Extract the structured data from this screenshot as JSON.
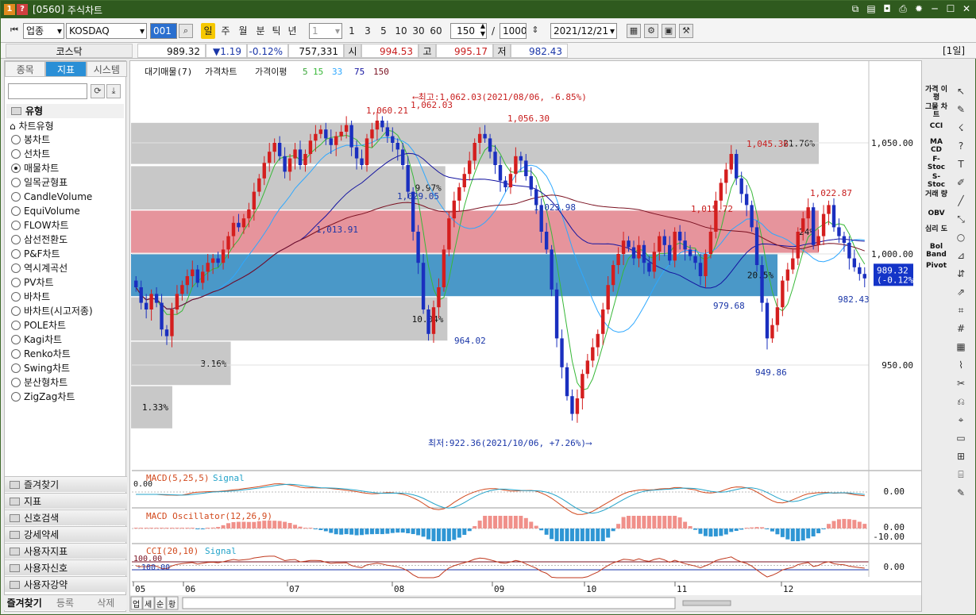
{
  "window": {
    "screen_no": "[0560]",
    "title": "주식차트",
    "badge1": "1",
    "badge2": "?"
  },
  "toolbar": {
    "category": "업종",
    "symbol": "KOSDAQ",
    "code": "001",
    "periods": [
      "일",
      "주",
      "월",
      "분",
      "틱",
      "년"
    ],
    "active_period": "일",
    "interval": "1",
    "intervals": [
      "1",
      "3",
      "5",
      "10",
      "30",
      "60"
    ],
    "count": "150",
    "total": "1000",
    "separator": "/",
    "date": "2021/12/21"
  },
  "infobar": {
    "name": "코스닥",
    "price": "989.32",
    "change": "▼1.19",
    "change_pct": "-0.12%",
    "volume": "757,331",
    "open_label": "시",
    "open": "994.53",
    "high_label": "고",
    "high": "995.17",
    "low_label": "저",
    "low": "982.43",
    "period_tag": "[1일]"
  },
  "left_panel": {
    "tabs": [
      "종목",
      "지표",
      "시스템"
    ],
    "active_tab": "지표",
    "type_header": "유형",
    "chart_type_group": "차트유형",
    "chart_types": [
      "봉차트",
      "선차트",
      "매물차트",
      "일목균형표",
      "CandleVolume",
      "EquiVolume",
      "FLOW차트",
      "삼선전환도",
      "P&F차트",
      "역시계곡선",
      "PV차트",
      "바차트",
      "바차트(시고저종)",
      "POLE차트",
      "Kagi차트",
      "Renko차트",
      "Swing차트",
      "분산형차트",
      "ZigZag차트"
    ],
    "selected_chart_type": "매물차트",
    "folders": [
      "즐겨찾기",
      "지표",
      "신호검색",
      "강세약세",
      "사용자지표",
      "사용자신호",
      "사용자강약"
    ],
    "bottom_tabs": [
      "즐겨찾기",
      "등록",
      "삭제"
    ]
  },
  "chart": {
    "legend": [
      "대기매물(7)",
      "가격차트",
      "가격이평",
      "5",
      "15",
      "33",
      "75",
      "150"
    ],
    "legend_colors": [
      "#222222",
      "#222222",
      "#3aa63a",
      "#38b838",
      "#2ea8ff",
      "#1414a0",
      "#7a1020"
    ],
    "annot_high": "⟵최고:1,062.03(2021/08/06, -6.85%)",
    "annot_low": "최저:922.36(2021/10/06, +7.26%)⟶",
    "price_labels": [
      {
        "text": "1,060.21",
        "color": "#c81e1e"
      },
      {
        "text": "1,062.03",
        "color": "#c81e1e"
      },
      {
        "text": "1,056.30",
        "color": "#c81e1e"
      },
      {
        "text": "1,045.36",
        "color": "#c81e1e"
      },
      {
        "text": "1,022.87",
        "color": "#c81e1e"
      },
      {
        "text": "1,015.72",
        "color": "#c81e1e"
      },
      {
        "text": "1,013.91",
        "color": "#1a36a8"
      },
      {
        "text": "1,029.05",
        "color": "#1a36a8"
      },
      {
        "text": "1,023.98",
        "color": "#1a36a8"
      },
      {
        "text": "964.02",
        "color": "#1a36a8"
      },
      {
        "text": "979.68",
        "color": "#1a36a8"
      },
      {
        "text": "949.86",
        "color": "#1a36a8"
      },
      {
        "text": "982.43",
        "color": "#1a36a8"
      }
    ],
    "volume_profile": [
      {
        "pct": "1.33%",
        "size": 0.06,
        "color": "#c8c8c8"
      },
      {
        "pct": "3.16%",
        "size": 0.145,
        "color": "#c8c8c8"
      },
      {
        "pct": "10.04%",
        "size": 0.46,
        "color": "#c8c8c8"
      },
      {
        "pct": "20.5%",
        "size": 0.94,
        "color": "#4a98c8"
      },
      {
        "pct": "24%",
        "size": 1.0,
        "color": "#e6949c"
      },
      {
        "pct": "9.97%",
        "size": 0.457,
        "color": "#c8c8c8"
      },
      {
        "pct": "21.76%",
        "size": 1.0,
        "color": "#c8c8c8"
      }
    ],
    "y_axis": [
      "1,050.00",
      "1,000.00",
      "950.00"
    ],
    "current_price": "989.32",
    "current_change": "(-0.12%)",
    "x_axis": [
      "05",
      "06",
      "07",
      "08",
      "09",
      "10",
      "11",
      "12"
    ],
    "bottom_icons": [
      "업",
      "세",
      "순",
      "황"
    ]
  },
  "macd": {
    "title": "MACD(5,25,5)",
    "signal": "Signal",
    "zero": "0.00",
    "axis": "0.00"
  },
  "osc": {
    "title": "MACD Oscillator(12,26,9)",
    "axis_a": "0.00",
    "axis_b": "-10.00"
  },
  "cci": {
    "title": "CCI(20,10)",
    "signal": "Signal",
    "ref_a": "100.00",
    "ref_b": "-100.00",
    "axis": "0.00"
  },
  "right_bar": [
    "가격 이평",
    "그물 차트",
    "CCI",
    "MA CD",
    "F-Stoc",
    "S-Stoc",
    "거래 량",
    "OBV",
    "심리 도",
    "Bol Band",
    "Pivot"
  ],
  "chart_data": {
    "type": "candlestick",
    "title": "KOSDAQ",
    "ylim": [
      920,
      1075
    ],
    "ylabel": "",
    "xlabel": "",
    "x_ticks": [
      "05",
      "06",
      "07",
      "08",
      "09",
      "10",
      "11",
      "12"
    ],
    "close": [
      985,
      978,
      975,
      982,
      978,
      966,
      963,
      975,
      982,
      986,
      990,
      993,
      987,
      992,
      996,
      998,
      996,
      1002,
      1008,
      1014,
      1012,
      1016,
      1020,
      1028,
      1034,
      1041,
      1046,
      1050,
      1044,
      1037,
      1043,
      1047,
      1040,
      1045,
      1051,
      1054,
      1056,
      1052,
      1049,
      1053,
      1055,
      1058,
      1048,
      1043,
      1040,
      1052,
      1056,
      1060,
      1057,
      1053,
      1050,
      1047,
      1040,
      1028,
      1010,
      996,
      975,
      964,
      976,
      985,
      1002,
      1016,
      1024,
      1030,
      1036,
      1042,
      1050,
      1054,
      1052,
      1046,
      1040,
      1033,
      1030,
      1036,
      1044,
      1042,
      1035,
      1029,
      1022,
      1010,
      1002,
      984,
      962,
      949,
      936,
      928,
      935,
      946,
      952,
      958,
      964,
      975,
      986,
      995,
      1000,
      1006,
      1003,
      998,
      1004,
      996,
      992,
      1001,
      1008,
      1004,
      997,
      1010,
      1006,
      1002,
      999,
      996,
      990,
      1000,
      1010,
      1024,
      1032,
      1038,
      1045,
      1034,
      1027,
      1022,
      1012,
      995,
      978,
      962,
      968,
      976,
      988,
      993,
      998,
      1010,
      1016,
      1021,
      1004,
      1008,
      1018,
      1022,
      1012,
      1008,
      1005,
      998,
      994,
      991,
      989
    ]
  }
}
